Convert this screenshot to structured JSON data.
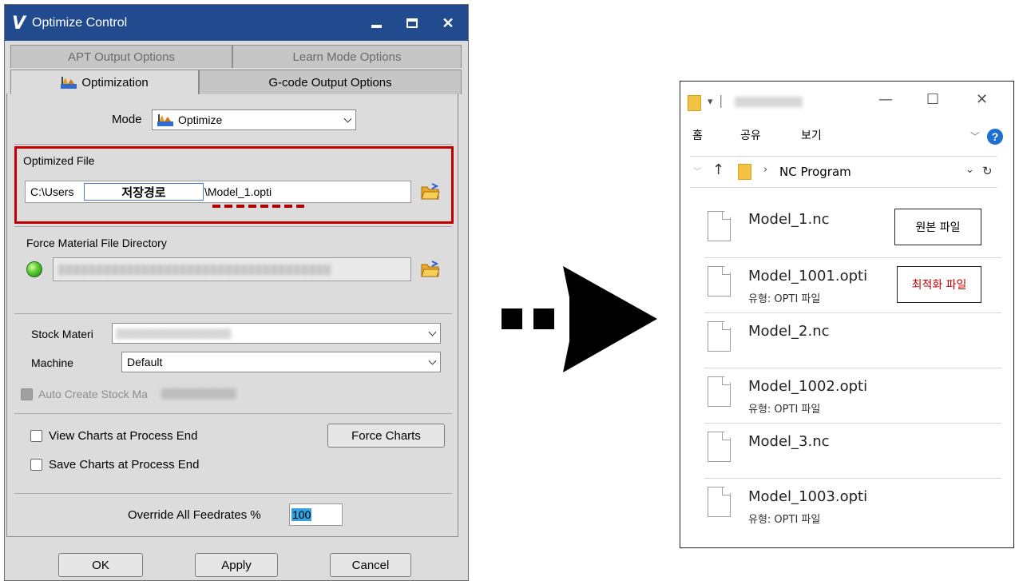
{
  "dialog": {
    "title": "Optimize Control",
    "app_icon": "V",
    "tabs_back": [
      "APT Output Options",
      "Learn Mode Options"
    ],
    "tabs_front": [
      "Optimization",
      "G-code Output Options"
    ],
    "mode_label": "Mode",
    "mode_value": "Optimize",
    "optimized_file_label": "Optimized File",
    "optimized_file_prefix": "C:\\Users",
    "optimized_file_suffix": "\\Model_1.opti",
    "save_path_overlay": "저장경로",
    "force_material_label": "Force Material File Directory",
    "stock_material_label": "Stock Materi",
    "machine_label": "Machine",
    "machine_value": "Default",
    "auto_create_label": "Auto Create Stock Ma",
    "view_charts_label": "View Charts at Process End",
    "save_charts_label": "Save Charts at Process End",
    "force_charts_button": "Force Charts",
    "override_label": "Override All Feedrates %",
    "override_value": "100",
    "ok_button": "OK",
    "apply_button": "Apply",
    "cancel_button": "Cancel"
  },
  "explorer": {
    "menu": [
      "홈",
      "공유",
      "보기"
    ],
    "path_folder": "NC Program",
    "files": [
      {
        "name": "Model_1.nc",
        "type": ""
      },
      {
        "name": "Model_1001.opti",
        "type": "유형: OPTI 파일"
      },
      {
        "name": "Model_2.nc",
        "type": ""
      },
      {
        "name": "Model_1002.opti",
        "type": "유형: OPTI 파일"
      },
      {
        "name": "Model_3.nc",
        "type": ""
      },
      {
        "name": "Model_1003.opti",
        "type": "유형: OPTI 파일"
      }
    ],
    "callout_original": "원본 파일",
    "callout_optimized": "최적화 파일"
  },
  "colors": {
    "titlebar": "#214a8f",
    "highlight_red": "#c00000",
    "selection_blue": "#36a3e0",
    "led_green": "#5fd034"
  }
}
